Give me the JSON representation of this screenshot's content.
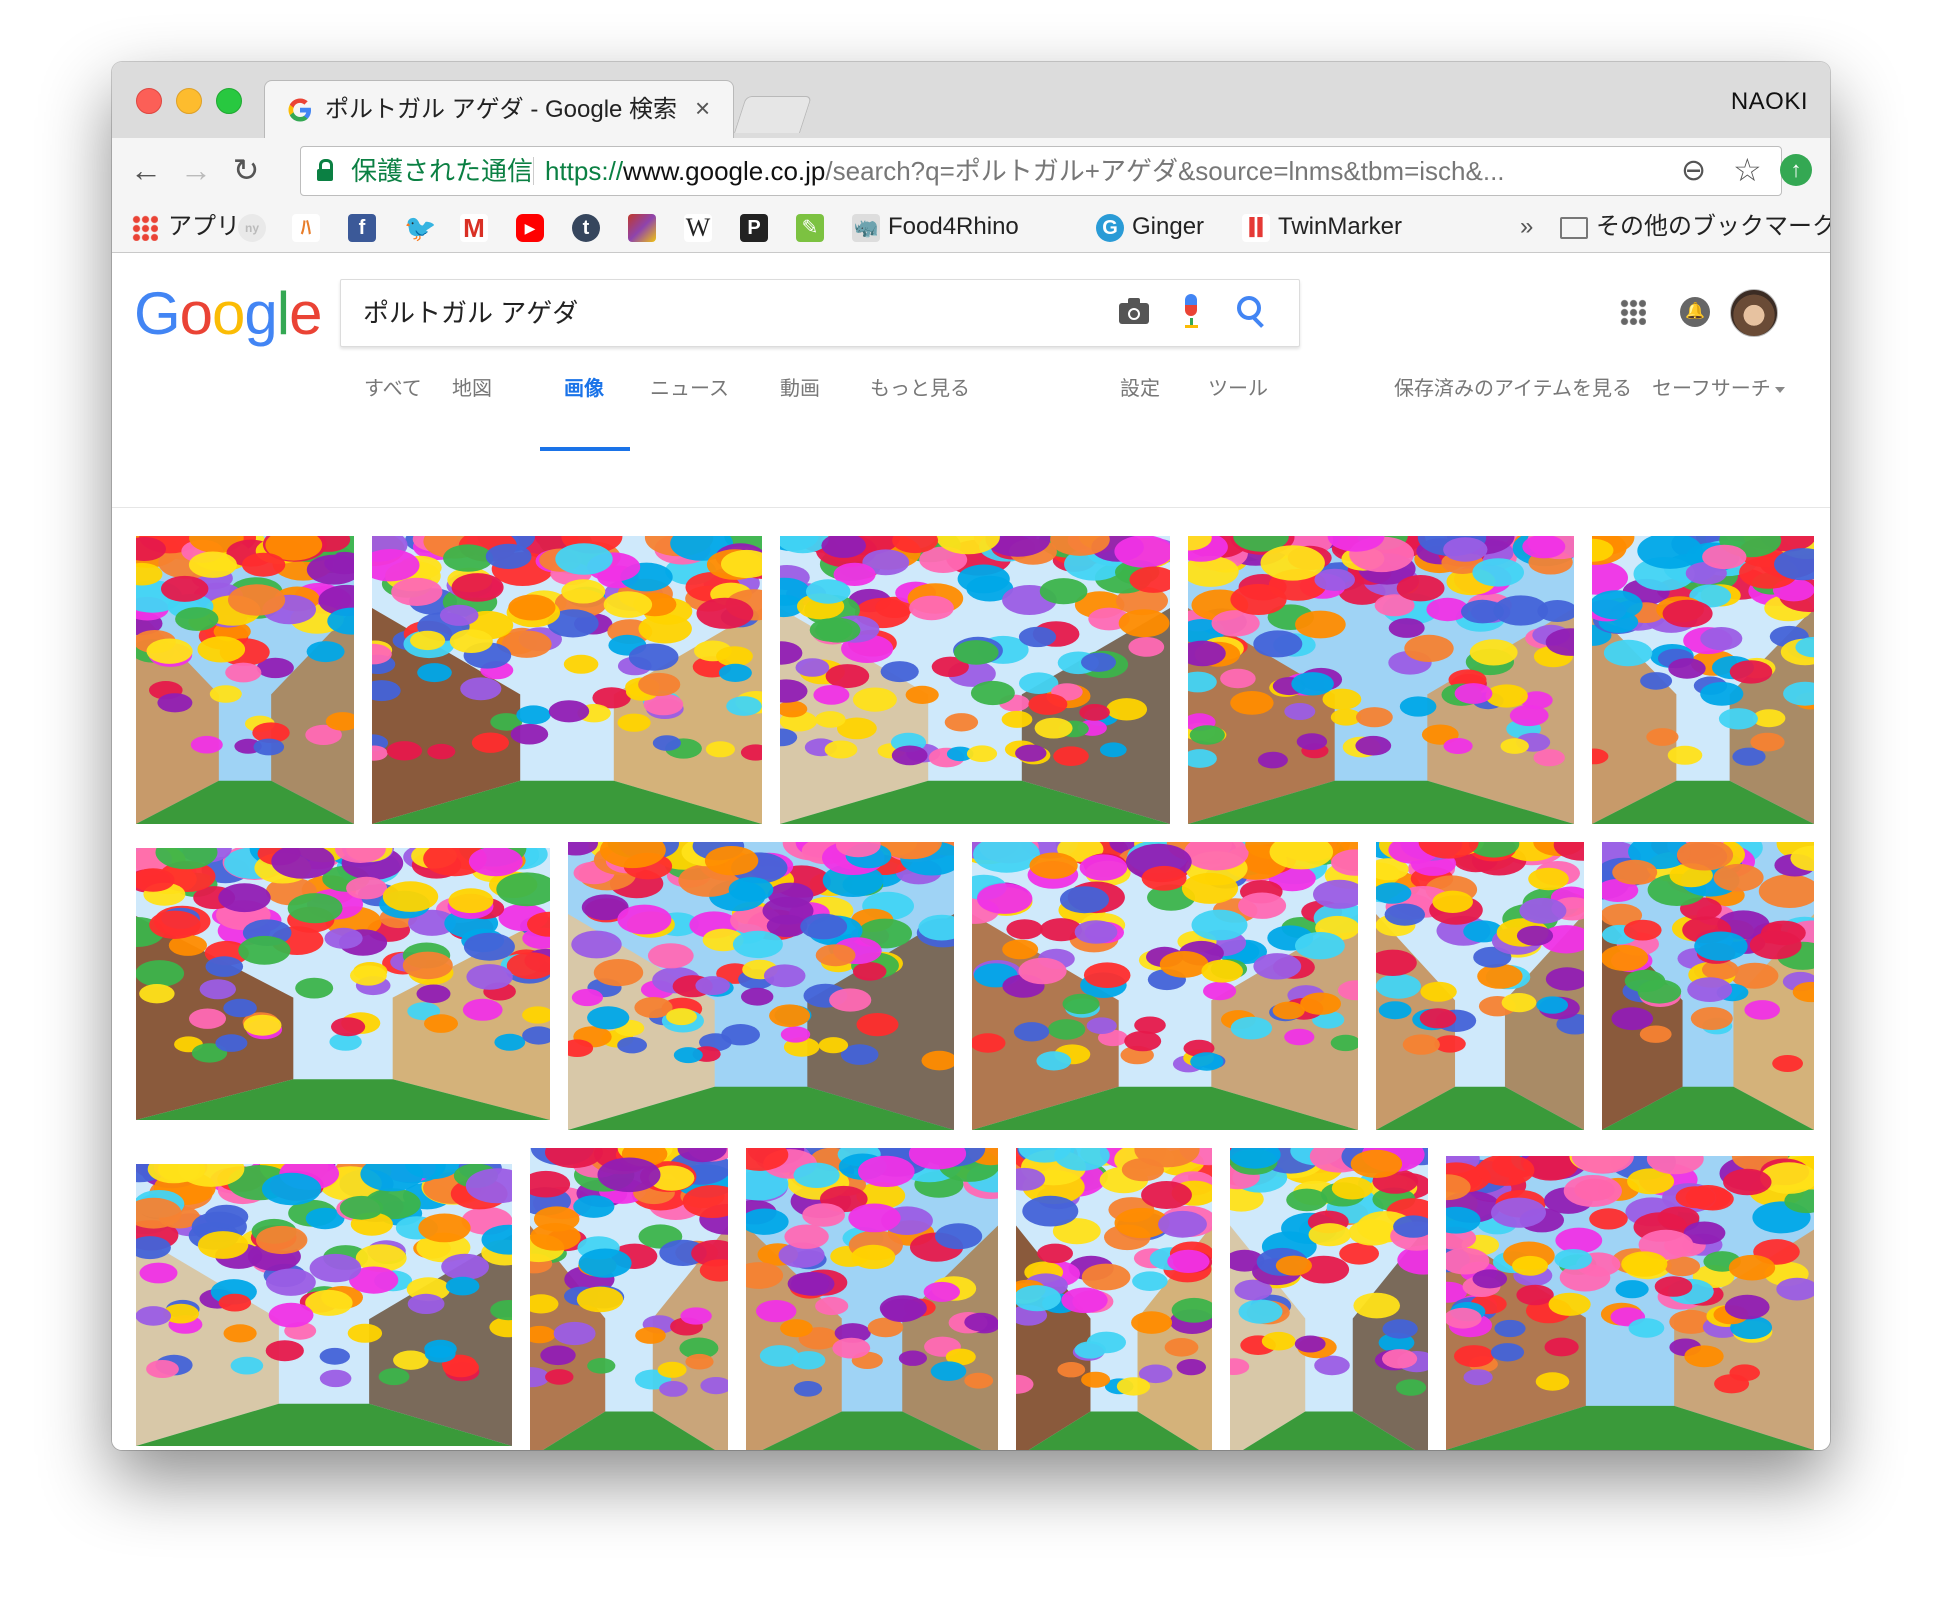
{
  "window": {
    "tab_title": "ポルトガル アゲダ - Google 検索",
    "tab_close": "×",
    "profile_name": "NAOKI"
  },
  "toolbar": {
    "back": "←",
    "forward": "→",
    "reload": "↻",
    "secure_label": "保護された通信",
    "url_scheme": "https://",
    "url_host": "www.google.co.jp",
    "url_rest": "/search?q=ポルトガル+アゲダ&source=lnms&tbm=isch&...",
    "zoom_icon": "⊖",
    "star_icon": "☆",
    "extension_icon": "↑"
  },
  "bookmarks": {
    "apps_label": "アプリ",
    "food4rhino": "Food4Rhino",
    "ginger": "Ginger",
    "twinmarker": "TwinMarker",
    "overflow": "»",
    "other_bookmarks": "その他のブックマーク"
  },
  "google": {
    "logo_letters": [
      "G",
      "o",
      "o",
      "g",
      "l",
      "e"
    ],
    "logo_colors": [
      "#4285f4",
      "#ea4335",
      "#fbbc05",
      "#4285f4",
      "#34a853",
      "#ea4335"
    ],
    "search_value": "ポルトガル アゲダ",
    "nav_tabs": [
      {
        "label": "すべて",
        "active": false
      },
      {
        "label": "地図",
        "active": false
      },
      {
        "label": "画像",
        "active": true
      },
      {
        "label": "ニュース",
        "active": false
      },
      {
        "label": "動画",
        "active": false
      },
      {
        "label": "もっと見る",
        "active": false
      }
    ],
    "settings": "設定",
    "tools": "ツール",
    "saved_items": "保存済みのアイテムを見る",
    "safe_search": "セーフサーチ"
  },
  "colors": {
    "accent": "#1a73e8",
    "secure_green": "#0b8043"
  }
}
